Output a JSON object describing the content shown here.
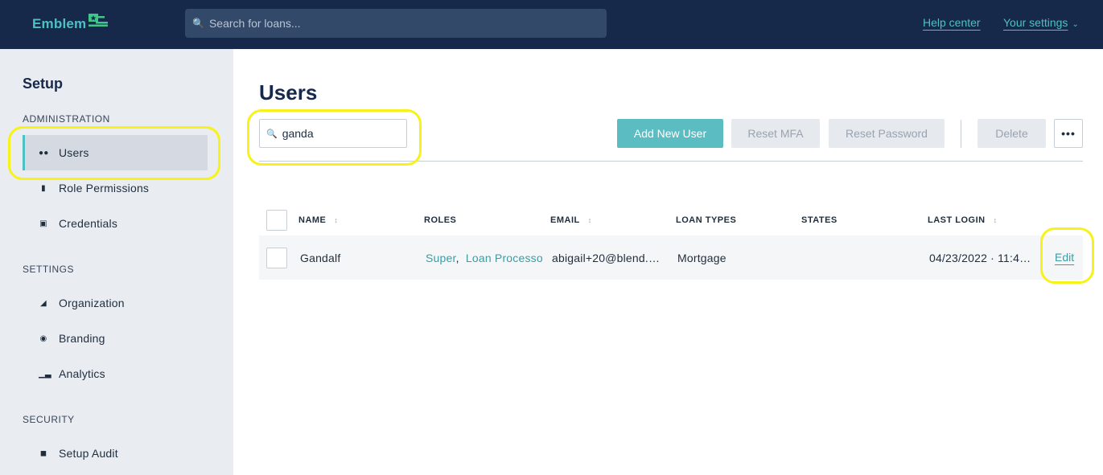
{
  "header": {
    "logo_text": "Emblem",
    "search_placeholder": "Search for loans...",
    "help_link": "Help center",
    "settings_link": "Your settings"
  },
  "sidebar": {
    "title": "Setup",
    "sections": [
      {
        "label": "ADMINISTRATION",
        "items": [
          {
            "label": "Users",
            "icon": "users-icon",
            "active": true
          },
          {
            "label": "Role Permissions",
            "icon": "lock-icon"
          },
          {
            "label": "Credentials",
            "icon": "id-card-icon"
          }
        ]
      },
      {
        "label": "SETTINGS",
        "items": [
          {
            "label": "Organization",
            "icon": "building-icon"
          },
          {
            "label": "Branding",
            "icon": "palette-icon"
          },
          {
            "label": "Analytics",
            "icon": "bar-chart-icon"
          }
        ]
      },
      {
        "label": "SECURITY",
        "items": [
          {
            "label": "Setup Audit",
            "icon": "audit-icon"
          }
        ]
      }
    ]
  },
  "main": {
    "title": "Users",
    "filter_value": "ganda",
    "buttons": {
      "add": "Add New User",
      "reset_mfa": "Reset MFA",
      "reset_password": "Reset Password",
      "delete": "Delete",
      "more": "•••"
    },
    "table": {
      "columns": [
        "NAME",
        "ROLES",
        "EMAIL",
        "LOAN TYPES",
        "STATES",
        "LAST LOGIN"
      ],
      "rows": [
        {
          "name": "Gandalf",
          "roles": [
            "Super",
            "Loan Processor"
          ],
          "email": "abigail+20@blend.…",
          "loan_types": "Mortgage",
          "states": "",
          "last_login": "04/23/2022 · 11:4…",
          "action": "Edit"
        }
      ]
    }
  },
  "colors": {
    "header_bg": "#17294a",
    "accent": "#4fbfc6",
    "primary_button": "#5bbcc1",
    "highlight": "#f7f21a"
  }
}
